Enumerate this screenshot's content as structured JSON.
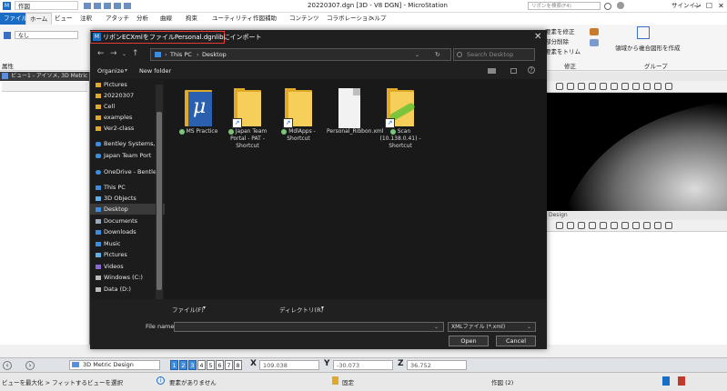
{
  "titlebar": {
    "workspace": "作図",
    "title": "20220307.dgn [3D - V8 DGN] - MicroStation",
    "search_placeholder": "リボンを検索(F4)",
    "sign_in": "サインイン"
  },
  "ribbon_tabs": [
    "ファイル",
    "ホーム",
    "ビュー",
    "注釈",
    "アタッチ",
    "分析",
    "曲線",
    "拘束",
    "ユーティリティ",
    "作図補助",
    "コンテンツ",
    "コラボレーション",
    "ヘルプ"
  ],
  "ribbon": {
    "none_value": "なし",
    "attr_label": "属性",
    "right_items": [
      "要素を修正",
      "部分削除",
      "要素をトリム"
    ],
    "modify_group": "修正",
    "create_complex": "領域から複合図形を作成",
    "group_label": "グループ"
  },
  "view1": {
    "title": "ビュー1 - アイソメ, 3D Metric Design"
  },
  "view3": {
    "title": "Design"
  },
  "dialog": {
    "title": "リボンECXmlをファイルPersonal.dgnlibにインポート",
    "breadcrumb": [
      "This PC",
      "Desktop"
    ],
    "search_placeholder": "Search Desktop",
    "organize": "Organize",
    "new_folder": "New folder",
    "sidebar": [
      {
        "label": "Pictures",
        "type": "folder"
      },
      {
        "label": "20220307",
        "type": "folder"
      },
      {
        "label": "Cell",
        "type": "folder"
      },
      {
        "label": "examples",
        "type": "folder"
      },
      {
        "label": "Ver2-class",
        "type": "folder"
      },
      {
        "label": "Bentley Systems, I",
        "type": "cloud"
      },
      {
        "label": "Japan Team Port",
        "type": "cloud"
      },
      {
        "label": "OneDrive - Bentle",
        "type": "cloud"
      },
      {
        "label": "This PC",
        "type": "pc"
      },
      {
        "label": "3D Objects",
        "type": "obj"
      },
      {
        "label": "Desktop",
        "type": "desktop"
      },
      {
        "label": "Documents",
        "type": "doc"
      },
      {
        "label": "Downloads",
        "type": "down"
      },
      {
        "label": "Music",
        "type": "music"
      },
      {
        "label": "Pictures",
        "type": "pic"
      },
      {
        "label": "Videos",
        "type": "video"
      },
      {
        "label": "Windows (C:)",
        "type": "drive"
      },
      {
        "label": "Data (D:)",
        "type": "drive"
      }
    ],
    "files": [
      {
        "label": "MS Practice",
        "kind": "app"
      },
      {
        "label": "Japan Team Portal - PAT - Shortcut",
        "kind": "folder-shortcut"
      },
      {
        "label": "MdlApps - Shortcut",
        "kind": "folder-shortcut"
      },
      {
        "label": "Personal_Ribbon.xml",
        "kind": "file"
      },
      {
        "label": "Scan (10.138.0.41) - Shortcut",
        "kind": "scan-shortcut"
      }
    ],
    "file_dropdown": "ファイル(F)",
    "dir_dropdown": "ディレクトリ(R)",
    "file_name_label": "File name:",
    "file_name_value": "",
    "file_type": "XMLファイル (*.xml)",
    "open_button": "Open",
    "cancel_button": "Cancel"
  },
  "status": {
    "model": "3D Metric Design",
    "view_numbers": [
      "1",
      "2",
      "3",
      "4",
      "5",
      "6",
      "7",
      "8"
    ],
    "x_label": "X",
    "x_value": "109.038",
    "y_label": "Y",
    "y_value": "-30.073",
    "z_label": "Z",
    "z_value": "36.752",
    "prompt": "ビューを最大化 > フィットするビューを選択",
    "message": "要素がありません",
    "lock": "固定",
    "level": "作図 (2)"
  }
}
